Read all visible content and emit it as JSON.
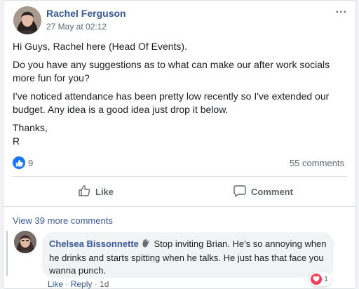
{
  "post": {
    "author": "Rachel Ferguson",
    "timestamp": "27 May at 02:12",
    "more_icon": "...",
    "paragraphs": [
      "Hi Guys, Rachel here (Head Of Events).",
      "Do you have any suggestions as to what can make our after work socials more fun for you?",
      "I've noticed attendance has been pretty low recently so I've extended our budget. Any idea is a good idea just drop it below."
    ],
    "thanks": "Thanks,",
    "signoff": "R",
    "reaction_count": "9",
    "comments_count": "55 comments"
  },
  "actions": {
    "like": "Like",
    "comment": "Comment"
  },
  "view_more": "View 39 more comments",
  "comment": {
    "author": "Chelsea Bissonnette",
    "text": "Stop inviting Brian. He's so annoying when he drinks and starts spitting when he talks. He just has that face you wanna punch.",
    "reaction_count": "1",
    "like": "Like",
    "reply": "Reply",
    "sep": " · ",
    "age": "1d"
  },
  "colors": {
    "link_blue": "#385898",
    "like_blue": "#1877f2",
    "heart_red": "#f33e58",
    "bubble_bg": "#f2f3f5"
  }
}
